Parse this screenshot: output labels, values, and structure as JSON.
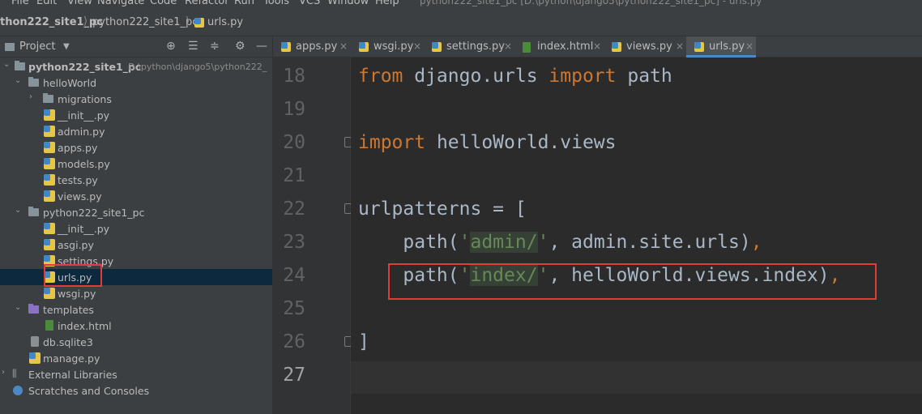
{
  "menu": {
    "items": [
      "File",
      "Edit",
      "View",
      "Navigate",
      "Code",
      "Refactor",
      "Run",
      "Tools",
      "VCS",
      "Window",
      "Help"
    ],
    "window_title": "python222_site1_pc [D:\\python\\django5\\python222_site1_pc] - urls.py"
  },
  "breadcrumb": {
    "project": "thon222_site1_pc",
    "folder": "python222_site1_pc",
    "file": "urls.py"
  },
  "project_panel": {
    "title": "Project",
    "icons": [
      "globe-icon",
      "collapse-icon",
      "expand-icon",
      "gear-icon",
      "minimize-icon"
    ]
  },
  "tree": {
    "root_name": "python222_site1_pc",
    "root_path": "D:\\python\\django5\\python222_",
    "helloworld": "helloWorld",
    "migrations": "migrations",
    "hw_init": "__init__.py",
    "admin": "admin.py",
    "apps": "apps.py",
    "models": "models.py",
    "tests": "tests.py",
    "views": "views.py",
    "pkg": "python222_site1_pc",
    "pkg_init": "__init__.py",
    "asgi": "asgi.py",
    "settings": "settings.py",
    "urls": "urls.py",
    "wsgi": "wsgi.py",
    "templates": "templates",
    "index_html": "index.html",
    "db": "db.sqlite3",
    "manage": "manage.py",
    "external": "External Libraries",
    "scratches": "Scratches and Consoles"
  },
  "tabs": [
    {
      "label": "apps.py",
      "type": "py"
    },
    {
      "label": "wsgi.py",
      "type": "py"
    },
    {
      "label": "settings.py",
      "type": "py"
    },
    {
      "label": "index.html",
      "type": "html"
    },
    {
      "label": "views.py",
      "type": "py"
    },
    {
      "label": "urls.py",
      "type": "py",
      "active": true
    }
  ],
  "editor": {
    "line_numbers": [
      "18",
      "19",
      "20",
      "21",
      "22",
      "23",
      "24",
      "25",
      "26",
      "27"
    ],
    "code": {
      "l18_kw1": "from",
      "l18_mod": " django.urls ",
      "l18_kw2": "import",
      "l18_name": " path",
      "l20_kw": "import",
      "l20_mod": " helloWorld.views",
      "l22": "urlpatterns = [",
      "l23_a": "    path(",
      "l23_q1": "'",
      "l23_s": "admin/",
      "l23_q2": "'",
      "l23_b": ", admin.site.urls)",
      "l23_c": ",",
      "l24_a": "    path(",
      "l24_q1": "'",
      "l24_s": "index/",
      "l24_q2": "'",
      "l24_b": ", helloWorld.views.index)",
      "l24_c": ",",
      "l26": "]"
    }
  },
  "colors": {
    "keyword": "#cc7832",
    "string": "#6a8759",
    "text": "#a9b7c6",
    "highlight_box": "#e23b3b"
  }
}
